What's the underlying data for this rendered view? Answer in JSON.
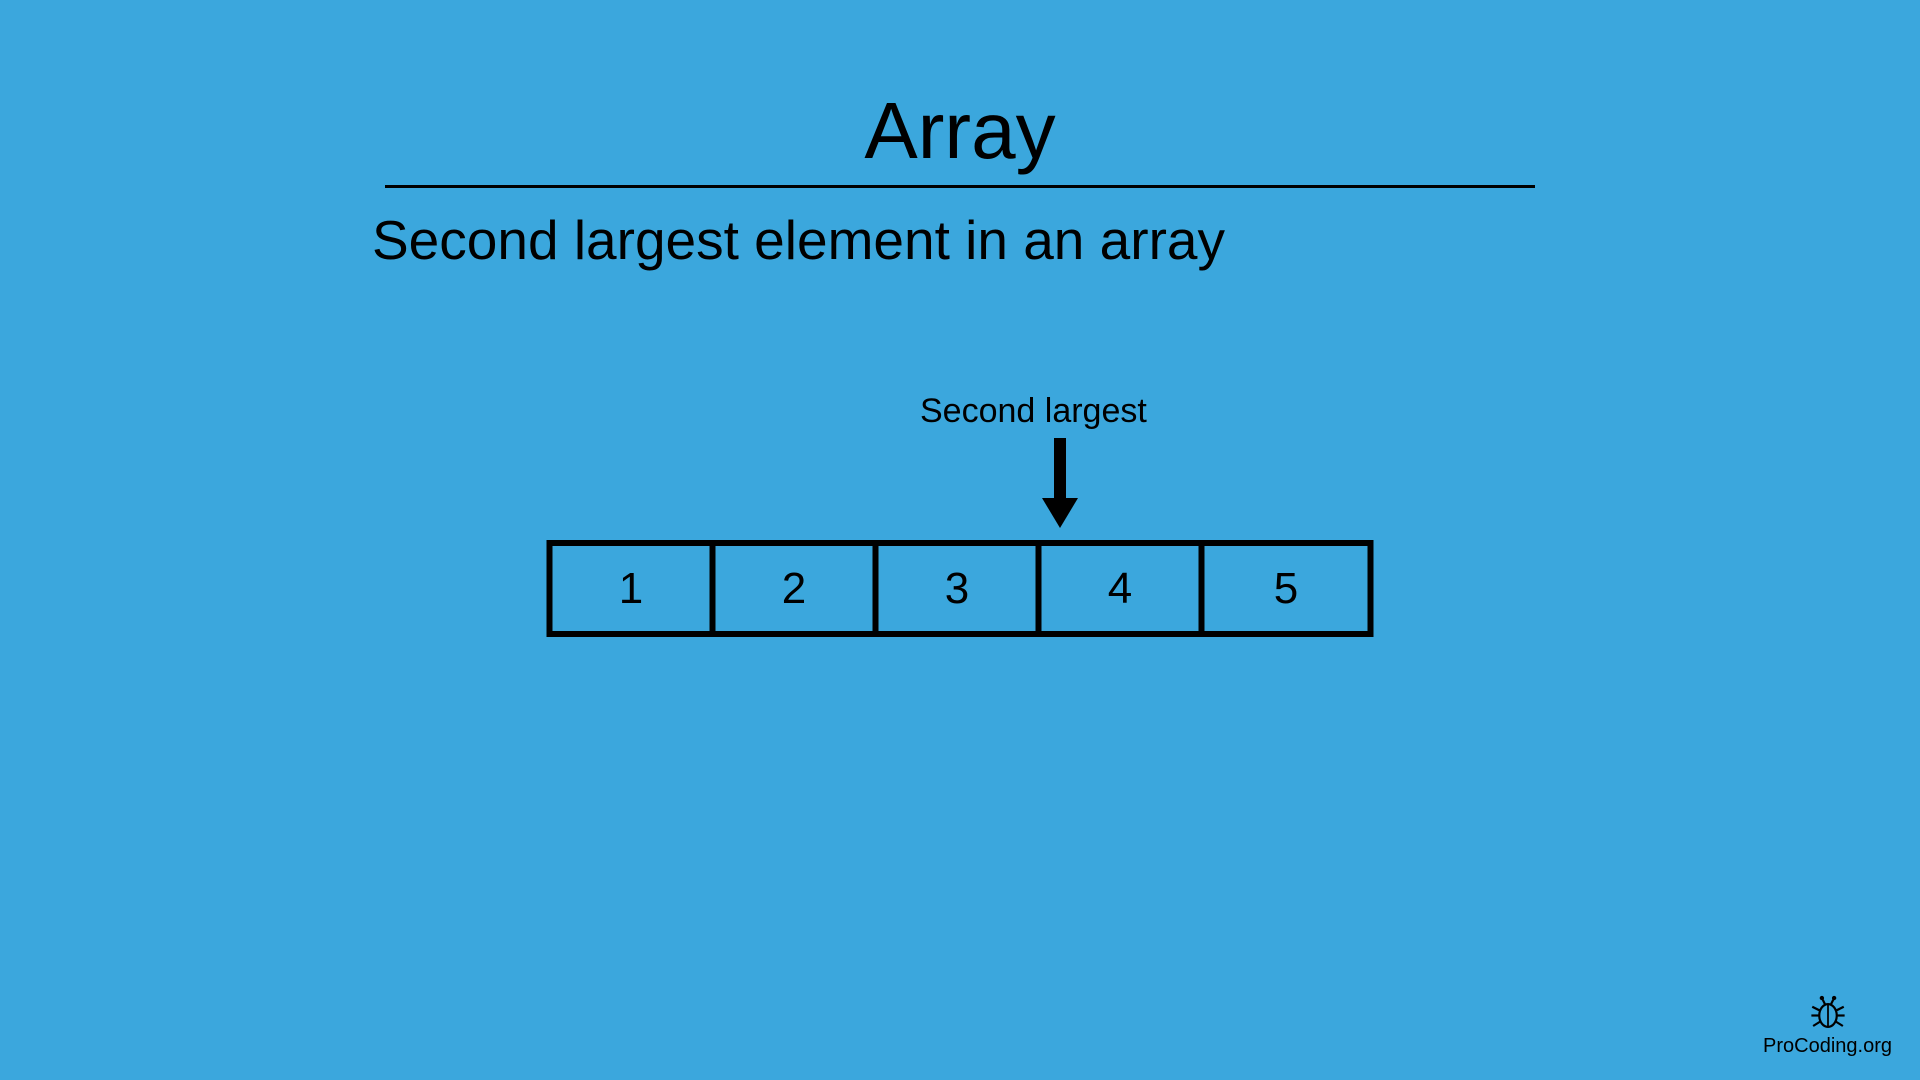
{
  "title": "Array",
  "subtitle": "Second largest element in an array",
  "annotation": "Second largest",
  "array": [
    "1",
    "2",
    "3",
    "4",
    "5"
  ],
  "logo": "ProCoding.org"
}
